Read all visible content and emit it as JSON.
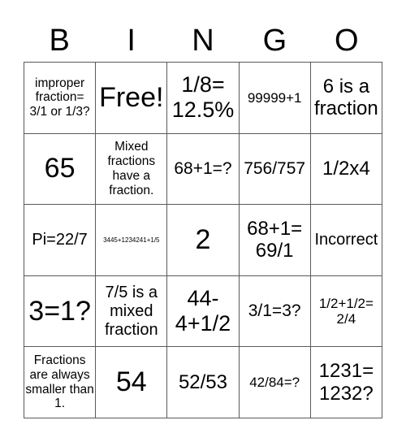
{
  "header": {
    "letters": [
      "B",
      "I",
      "N",
      "G",
      "O"
    ]
  },
  "board": {
    "rows": [
      [
        "improper fraction= 3/1 or 1/3?",
        "Free!",
        "1/8= 12.5%",
        "99999+1",
        "6 is a fraction"
      ],
      [
        "65",
        "Mixed fractions have a fraction.",
        "68+1=?",
        "756/757",
        "1/2x4"
      ],
      [
        "Pi=22/7",
        "3445+1234241+1/5",
        "2",
        "68+1= 69/1",
        "Incorrect"
      ],
      [
        "3=1?",
        "7/5 is a mixed fraction",
        "44- 4+1/2",
        "3/1=3?",
        "1/2+1/2= 2/4"
      ],
      [
        "Fractions are always smaller than 1.",
        "54",
        "52/53",
        "42/84=?",
        "1231= 1232?"
      ]
    ]
  },
  "colors": {
    "grid_line": "#5a5a5a",
    "text": "#000000",
    "background": "#ffffff"
  }
}
